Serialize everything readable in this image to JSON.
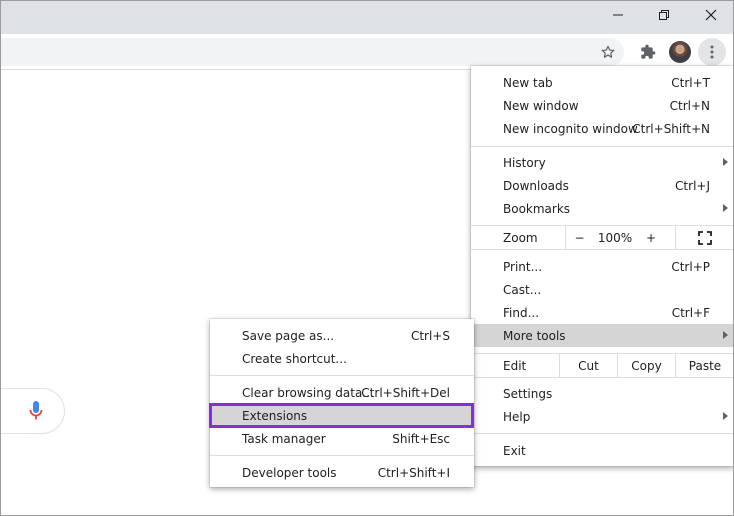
{
  "window": {
    "minimize_icon": "minimize-icon",
    "maximize_icon": "restore-icon",
    "close_icon": "close-icon"
  },
  "toolbar": {
    "bookmark_icon": "star-icon",
    "extensions_icon": "puzzle-icon",
    "profile_icon": "avatar",
    "menu_icon": "kebab-icon"
  },
  "main_menu": {
    "new_tab": {
      "label": "New tab",
      "shortcut": "Ctrl+T"
    },
    "new_window": {
      "label": "New window",
      "shortcut": "Ctrl+N"
    },
    "new_incognito": {
      "label": "New incognito window",
      "shortcut": "Ctrl+Shift+N"
    },
    "history": {
      "label": "History"
    },
    "downloads": {
      "label": "Downloads",
      "shortcut": "Ctrl+J"
    },
    "bookmarks": {
      "label": "Bookmarks"
    },
    "zoom": {
      "label": "Zoom",
      "minus": "−",
      "value": "100%",
      "plus": "+"
    },
    "print": {
      "label": "Print...",
      "shortcut": "Ctrl+P"
    },
    "cast": {
      "label": "Cast..."
    },
    "find": {
      "label": "Find...",
      "shortcut": "Ctrl+F"
    },
    "more_tools": {
      "label": "More tools"
    },
    "edit": {
      "label": "Edit",
      "cut": "Cut",
      "copy": "Copy",
      "paste": "Paste"
    },
    "settings": {
      "label": "Settings"
    },
    "help": {
      "label": "Help"
    },
    "exit": {
      "label": "Exit"
    }
  },
  "more_tools_menu": {
    "save_page": {
      "label": "Save page as...",
      "shortcut": "Ctrl+S"
    },
    "create_shortcut": {
      "label": "Create shortcut..."
    },
    "clear_data": {
      "label": "Clear browsing data...",
      "shortcut": "Ctrl+Shift+Del"
    },
    "extensions": {
      "label": "Extensions"
    },
    "task_manager": {
      "label": "Task manager",
      "shortcut": "Shift+Esc"
    },
    "developer_tools": {
      "label": "Developer tools",
      "shortcut": "Ctrl+Shift+I"
    }
  },
  "colors": {
    "highlight_outline": "#8a2be2",
    "mic_blue": "#4285f4",
    "mic_red": "#ea4335"
  }
}
